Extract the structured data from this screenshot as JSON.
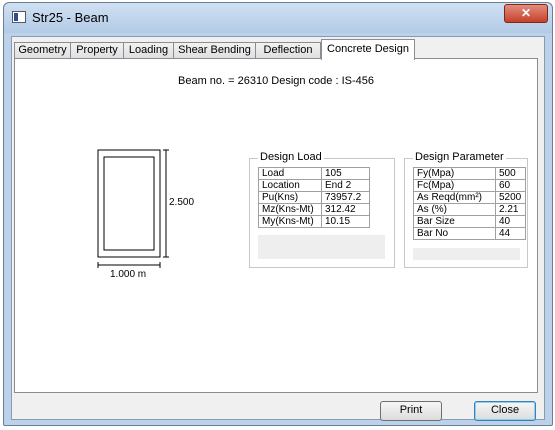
{
  "window": {
    "title": "Str25 - Beam",
    "close_glyph": "✕"
  },
  "tabs": [
    {
      "label": "Geometry"
    },
    {
      "label": "Property"
    },
    {
      "label": "Loading"
    },
    {
      "label": "Shear Bending"
    },
    {
      "label": "Deflection"
    },
    {
      "label": "Concrete Design",
      "active": true
    }
  ],
  "beam_info": "Beam no. = 26310  Design code :  IS-456",
  "section": {
    "depth_label": "2.500",
    "width_label": "1.000 m"
  },
  "design_load": {
    "title": "Design Load",
    "rows": [
      {
        "key": "Load",
        "value": "105"
      },
      {
        "key": "Location",
        "value": "End 2"
      },
      {
        "key": "Pu(Kns)",
        "value": "73957.2"
      },
      {
        "key": "Mz(Kns-Mt)",
        "value": "312.42"
      },
      {
        "key": "My(Kns-Mt)",
        "value": "10.15"
      }
    ]
  },
  "design_parameter": {
    "title": "Design Parameter",
    "rows": [
      {
        "key": "Fy(Mpa)",
        "value": "500"
      },
      {
        "key": "Fc(Mpa)",
        "value": "60"
      },
      {
        "key": "As Reqd(mm²)",
        "value": "5200"
      },
      {
        "key": "As (%)",
        "value": "2.21"
      },
      {
        "key": "Bar Size",
        "value": "40"
      },
      {
        "key": "Bar No",
        "value": "44"
      }
    ]
  },
  "buttons": {
    "print": "Print",
    "close": "Close"
  },
  "colors": {
    "title_bar": "#b9cfe8",
    "close_button": "#c94a35",
    "panel_bg": "#ffffff"
  }
}
